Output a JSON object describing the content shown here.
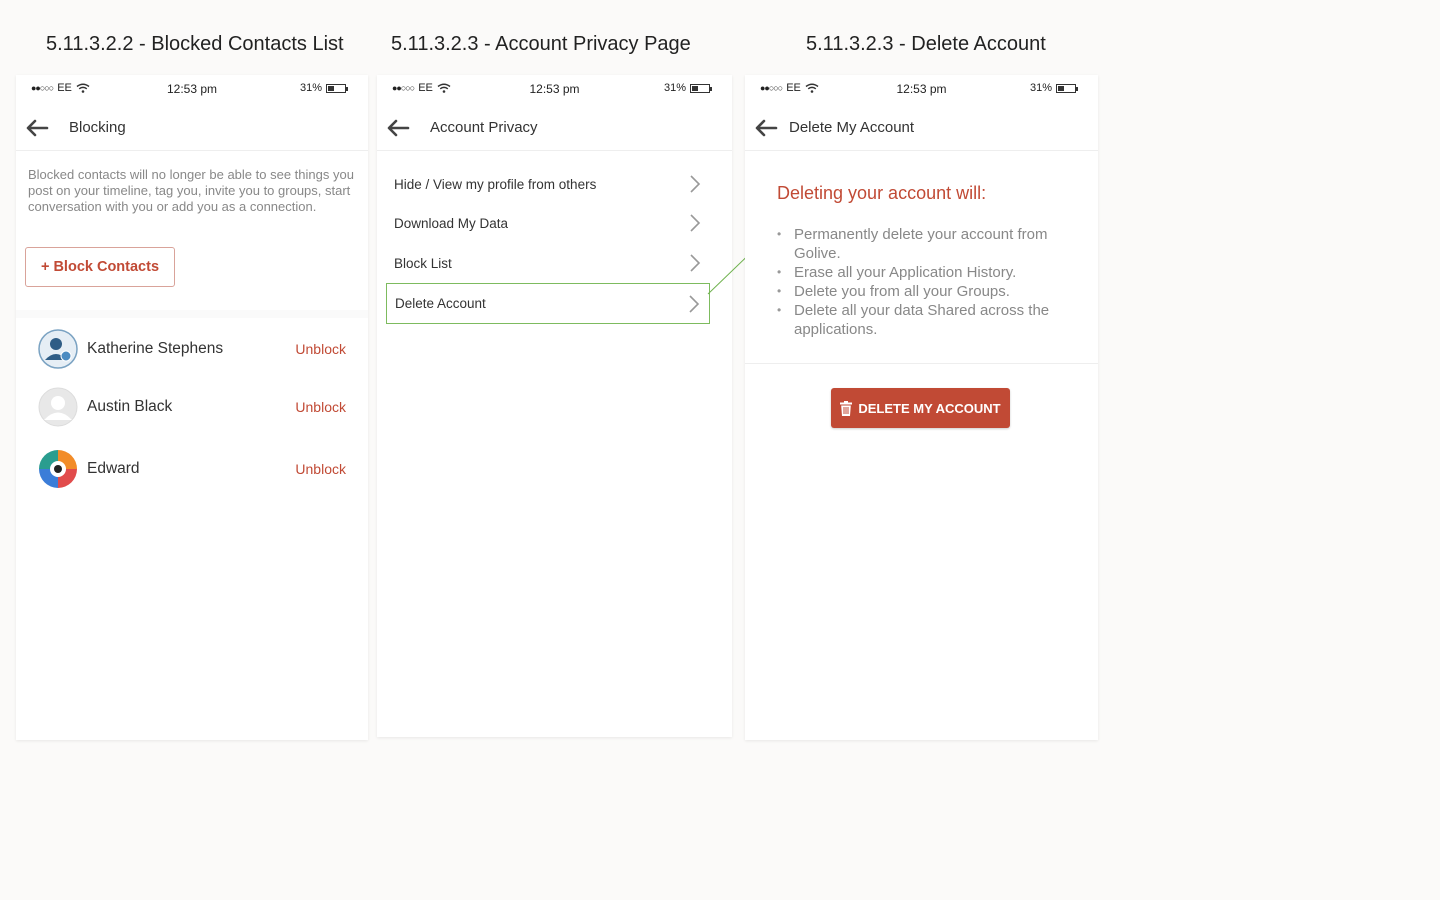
{
  "captions": {
    "screen1": "5.11.3.2.2 - Blocked Contacts List",
    "screen2": "5.11.3.2.3 - Account Privacy Page",
    "screen3": "5.11.3.2.3 - Delete Account"
  },
  "status_bar": {
    "carrier": "EE",
    "time": "12:53 pm",
    "battery": "31%"
  },
  "screen1": {
    "title": "Blocking",
    "description": "Blocked contacts will no longer be able to see things you post on your timeline, tag you, invite you to groups, start conversation with you or add you as a connection.",
    "block_button": "+ Block Contacts",
    "contacts": [
      {
        "name": "Katherine Stephens",
        "action": "Unblock"
      },
      {
        "name": "Austin Black",
        "action": "Unblock"
      },
      {
        "name": "Edward",
        "action": "Unblock"
      }
    ]
  },
  "screen2": {
    "title": "Account Privacy",
    "items": [
      {
        "label": "Hide / View my profile from others"
      },
      {
        "label": "Download My Data"
      },
      {
        "label": "Block List"
      },
      {
        "label": "Delete Account"
      }
    ]
  },
  "screen3": {
    "title": "Delete My Account",
    "heading": "Deleting your account will:",
    "bullets": [
      "Permanently delete your account from Golive.",
      "Erase all your Application History.",
      "Delete you from all your Groups.",
      "Delete all your data Shared across the applications."
    ],
    "button": "DELETE MY ACCOUNT"
  },
  "colors": {
    "accent": "#c14a35",
    "highlight_border": "#7dbb5e",
    "background": "#fbfaf9"
  }
}
